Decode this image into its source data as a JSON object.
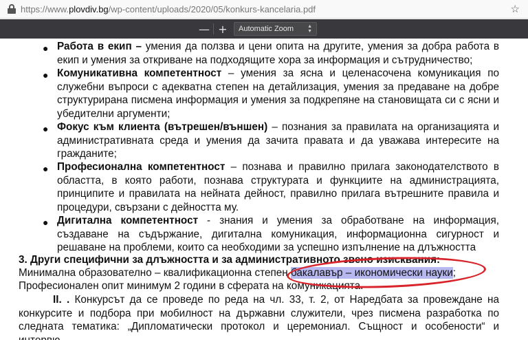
{
  "browser": {
    "url_scheme": "https://www.",
    "url_host": "plovdiv.bg",
    "url_path": "/wp-content/uploads/2020/05/konkurs-kancelaria.pdf"
  },
  "pdf_toolbar": {
    "zoom_out": "—",
    "zoom_in": "+",
    "zoom_select": "Automatic Zoom"
  },
  "doc": {
    "items": [
      {
        "term": "Работа в екип –",
        "text": " умения да ползва и цени опита на другите, умения за добра работа в екип и умения за откриване на подходящите хора за информация и сътрудничество;"
      },
      {
        "term": "Комуникативна компетентност",
        "text": " – умения за ясна и целенасочена комуникация по служебни въпроси с адекватна степен на детайлизация, умения за предаване на добре структурирана писмена информация и умения за подкрепяне на становищата си с ясни и убедителни аргументи;"
      },
      {
        "term": "Фокус към клиента (вътрешен/външен)",
        "text": " – познания за правилата на организацията и административната среда и умения да зачита правата и да уважава интересите на гражданите;"
      },
      {
        "term": "Професионална компетентност",
        "text": " – познава и правилно прилага законодателството в областта, в която работи, познава структурата и функциите на администрацията, принципите и правилата на нейната дейност, правилно прилага вътрешните правила и процедури, свързани с дейността му."
      },
      {
        "term": "Дигитална компетентност",
        "text": " - знания и умения за обработване на информация, създаване на съдържание, дигитална комуникация, информационна сигурност и решаване на проблеми, които са необходими за успешно изпълнение на длъжността"
      }
    ],
    "section3_heading": "3. Други специфични за длъжността и за административното звено изисквания:",
    "min_edu_prefix": "Минимална образователно – квалификационна степен ",
    "min_edu_value": "бакалавър – икономически науки",
    "min_edu_suffix": ";",
    "experience": "Професионален опит минимум 2 години в сферата на комуникацията.",
    "section2_num": "II. .",
    "section2_text": " Конкурсът да се проведе по реда на чл. 33, т. 2, от Наредбата за провеждане на конкурсите и подбора при мобилност на държавни служители, чрез писмена разработка по следната тематика: „Дипломатически протокол и церемониал. Същност и особености“ и интервю."
  }
}
